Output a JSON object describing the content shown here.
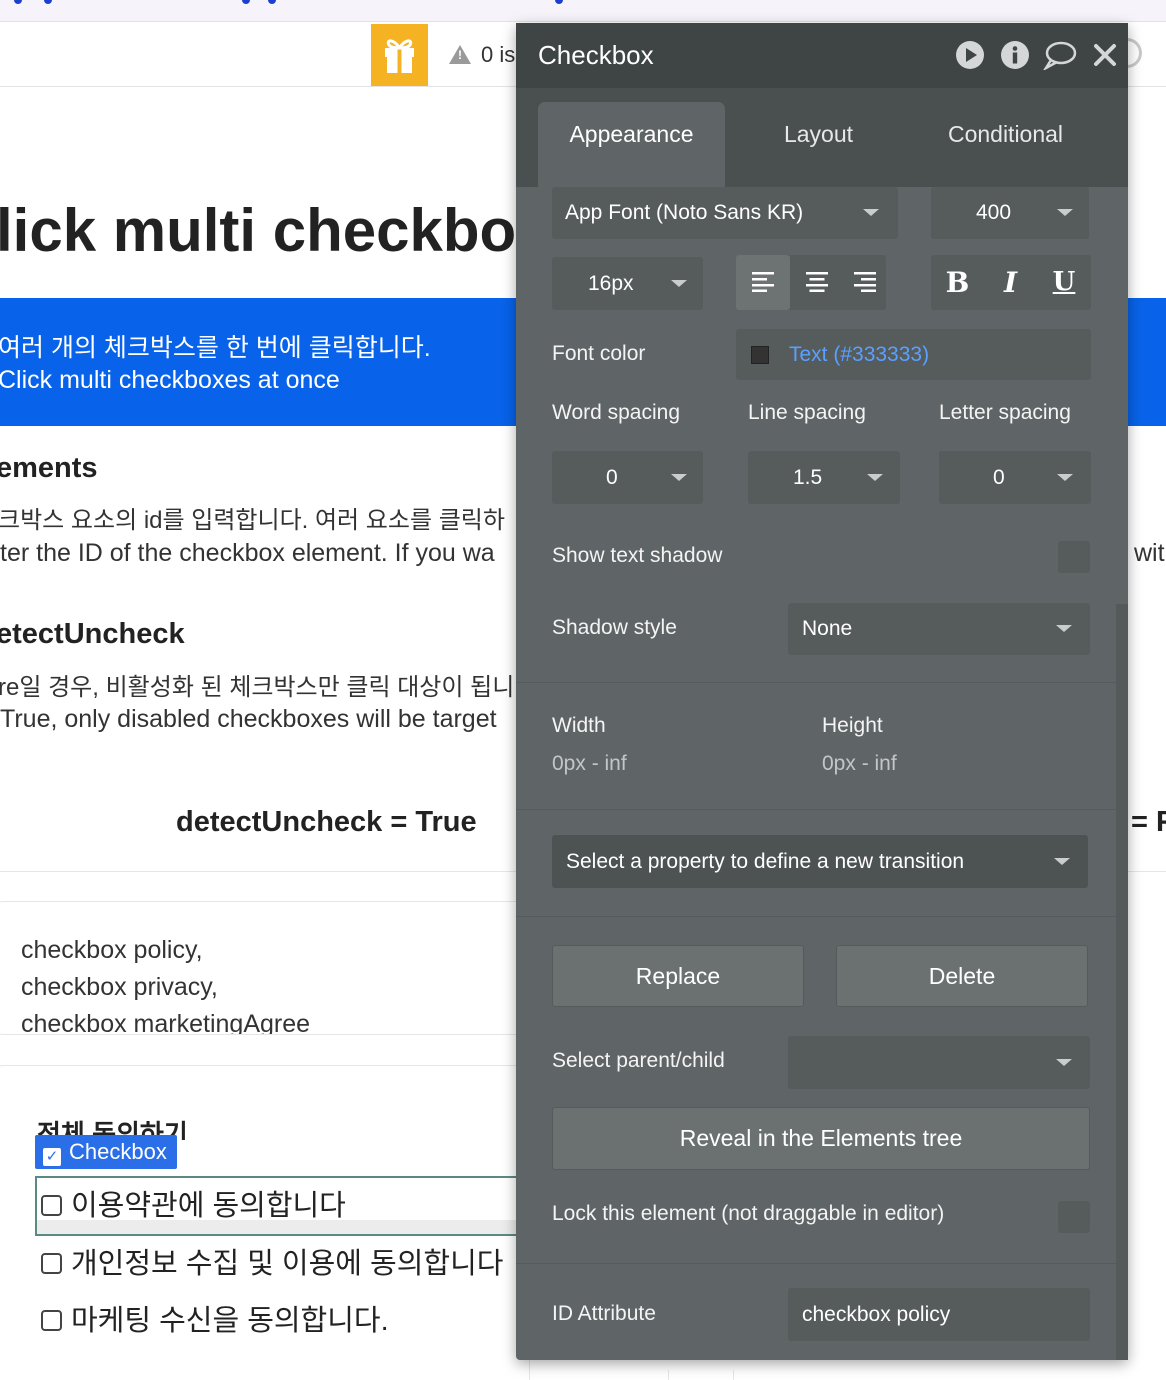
{
  "editor": {
    "issues_text": "0 is"
  },
  "page": {
    "title": "lick multi checkbox",
    "banner_line1": "여러 개의 체크박스를 한 번에 클릭합니다.",
    "banner_line2": "Click multi checkboxes at once",
    "elements_heading": "ements",
    "elements_desc_kr": "크박스 요소의 id를 입력합니다. 여러 요소를 클릭하",
    "elements_desc_en": "ter the ID of the checkbox element. If you wa",
    "elements_desc_en_right": "wit",
    "detect_heading": "etectUncheck",
    "detect_desc_kr": "re일 경우, 비활성화 된 체크박스만 클릭 대상이 됩니",
    "detect_desc_en": "True, only disabled checkboxes will be target",
    "col_true_label": "detectUncheck = True",
    "col_false_label": "= F",
    "id_list": [
      "checkbox policy,",
      "checkbox privacy,",
      "checkbox marketingAgree"
    ],
    "agree_all_partial": "전체 동의하기",
    "selected_badge": "Checkbox",
    "checkboxes": [
      "이용약관에 동의합니다",
      "개인정보 수집 및 이용에 동의합니다",
      "마케팅 수신을 동의합니다."
    ]
  },
  "panel": {
    "title": "Checkbox",
    "icons": [
      "play-icon",
      "info-icon",
      "comment-icon",
      "close-icon"
    ],
    "tabs": [
      {
        "label": "Appearance",
        "active": true
      },
      {
        "label": "Layout",
        "active": false
      },
      {
        "label": "Conditional",
        "active": false
      }
    ],
    "font_family": "App Font (Noto Sans KR)",
    "font_weight": "400",
    "font_size": "16px",
    "bold_label": "B",
    "italic_label": "I",
    "underline_label": "U",
    "font_color_label": "Font color",
    "font_color_value": "Text (#333333)",
    "font_color_swatch": "#333333",
    "word_spacing_label": "Word spacing",
    "line_spacing_label": "Line spacing",
    "letter_spacing_label": "Letter spacing",
    "word_spacing_value": "0",
    "line_spacing_value": "1.5",
    "letter_spacing_value": "0",
    "show_text_shadow_label": "Show text shadow",
    "shadow_style_label": "Shadow style",
    "shadow_style_value": "None",
    "width_label": "Width",
    "width_value": "0px - inf",
    "height_label": "Height",
    "height_value": "0px - inf",
    "transition_select": "Select a property to define a new transition",
    "replace_label": "Replace",
    "delete_label": "Delete",
    "parent_child_label": "Select parent/child",
    "reveal_label": "Reveal in the Elements tree",
    "lock_label": "Lock this element (not draggable in editor)",
    "id_attribute_label": "ID Attribute",
    "id_attribute_value": "checkbox policy"
  },
  "colors": {
    "banner": "#0863ea",
    "panel_bg": "#5f6466",
    "panel_header": "#3f4445",
    "link_blue": "#5aa0ff",
    "gift": "#f5b324"
  }
}
